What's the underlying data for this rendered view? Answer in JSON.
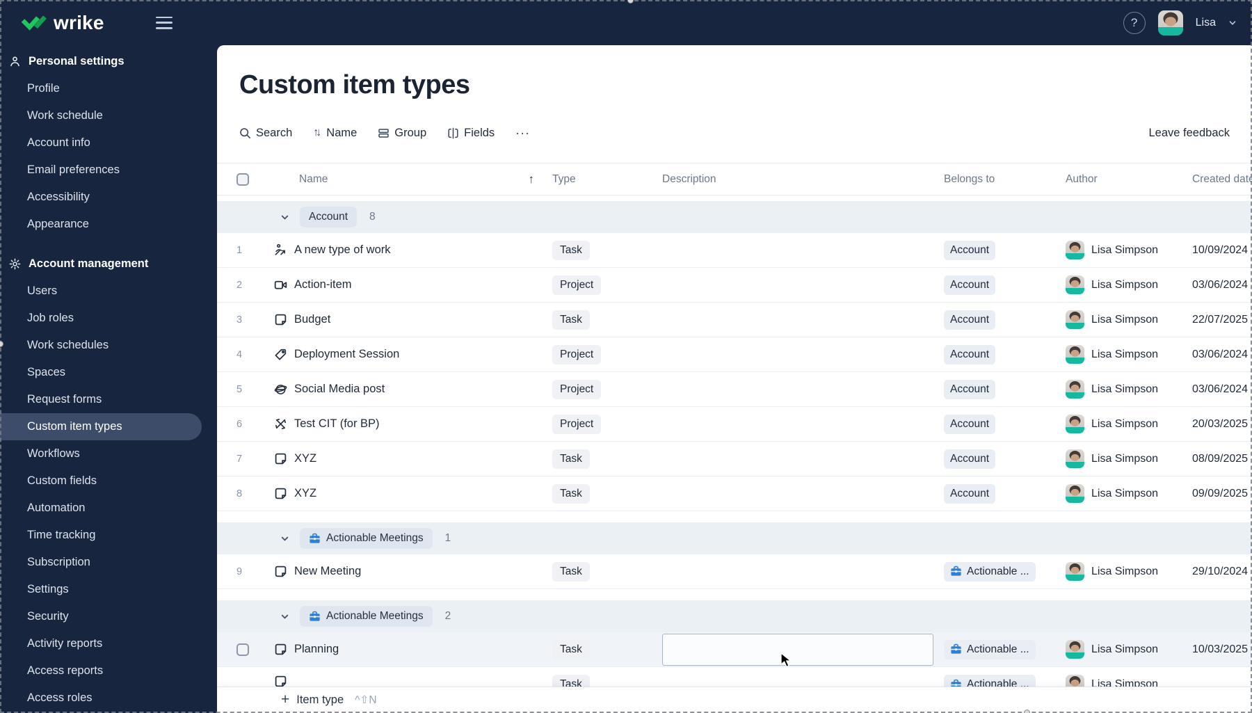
{
  "colors": {
    "brand_green": "#21C561",
    "navy": "#17263E",
    "briefcase_blue": "#2E7FD4",
    "group_band": "#EAF0F4"
  },
  "topbar": {
    "logo_text": "wrike",
    "help_label": "?",
    "user_name": "Lisa"
  },
  "sidebar": {
    "sections": [
      {
        "label": "Personal settings",
        "icon": "person-icon",
        "items": [
          {
            "label": "Profile"
          },
          {
            "label": "Work schedule"
          },
          {
            "label": "Account info"
          },
          {
            "label": "Email preferences"
          },
          {
            "label": "Accessibility"
          },
          {
            "label": "Appearance"
          }
        ]
      },
      {
        "label": "Account management",
        "icon": "gear-icon",
        "items": [
          {
            "label": "Users"
          },
          {
            "label": "Job roles"
          },
          {
            "label": "Work schedules"
          },
          {
            "label": "Spaces"
          },
          {
            "label": "Request forms"
          },
          {
            "label": "Custom item types",
            "selected": true
          },
          {
            "label": "Workflows"
          },
          {
            "label": "Custom fields"
          },
          {
            "label": "Automation"
          },
          {
            "label": "Time tracking"
          },
          {
            "label": "Subscription"
          },
          {
            "label": "Settings"
          },
          {
            "label": "Security"
          },
          {
            "label": "Activity reports"
          },
          {
            "label": "Access reports"
          },
          {
            "label": "Access roles"
          }
        ]
      }
    ]
  },
  "main": {
    "title": "Custom item types",
    "toolbar": {
      "search_label": "Search",
      "sort_label": "Name",
      "group_label": "Group",
      "fields_label": "Fields",
      "more_label": "···",
      "leave_feedback_label": "Leave feedback"
    },
    "table": {
      "header": {
        "name": "Name",
        "sort_dir": "↑",
        "type": "Type",
        "description": "Description",
        "belongs_to": "Belongs to",
        "author": "Author",
        "created_date": "Created date"
      },
      "groups": [
        {
          "label": "Account",
          "count": "8",
          "icon": null,
          "rows": [
            {
              "num": "1",
              "icon": "person-trend-icon",
              "name": "A new type of work",
              "type": "Task",
              "belongs_to": "Account",
              "author": "Lisa Simpson",
              "created": "10/09/2024"
            },
            {
              "num": "2",
              "icon": "video-camera-icon",
              "name": "Action-item",
              "type": "Project",
              "belongs_to": "Account",
              "author": "Lisa Simpson",
              "created": "03/06/2024"
            },
            {
              "num": "3",
              "icon": "note-icon",
              "name": "Budget",
              "type": "Task",
              "belongs_to": "Account",
              "author": "Lisa Simpson",
              "created": "22/07/2025"
            },
            {
              "num": "4",
              "icon": "tag-icon",
              "name": "Deployment Session",
              "type": "Project",
              "belongs_to": "Account",
              "author": "Lisa Simpson",
              "created": "03/06/2024"
            },
            {
              "num": "5",
              "icon": "globe-icon",
              "name": "Social Media post",
              "type": "Project",
              "belongs_to": "Account",
              "author": "Lisa Simpson",
              "created": "03/06/2024"
            },
            {
              "num": "6",
              "icon": "pinwheel-icon",
              "name": "Test CIT (for BP)",
              "type": "Project",
              "belongs_to": "Account",
              "author": "Lisa Simpson",
              "created": "20/03/2025"
            },
            {
              "num": "7",
              "icon": "note-icon",
              "name": "XYZ",
              "type": "Task",
              "belongs_to": "Account",
              "author": "Lisa Simpson",
              "created": "08/09/2025"
            },
            {
              "num": "8",
              "icon": "note-icon",
              "name": "XYZ",
              "type": "Task",
              "belongs_to": "Account",
              "author": "Lisa Simpson",
              "created": "09/09/2025"
            }
          ]
        },
        {
          "label": "Actionable Meetings",
          "count": "1",
          "icon": "briefcase-icon",
          "rows": [
            {
              "num": "9",
              "icon": "note-icon",
              "name": "New Meeting",
              "type": "Task",
              "belongs_to": "Actionable ...",
              "belongs_icon": "briefcase-icon",
              "author": "Lisa Simpson",
              "created": "29/10/2024"
            }
          ]
        },
        {
          "label": "Actionable Meetings",
          "count": "2",
          "icon": "briefcase-icon",
          "rows": [
            {
              "num": "",
              "icon": "note-icon",
              "name": "Planning",
              "type": "Task",
              "belongs_to": "Actionable ...",
              "belongs_icon": "briefcase-icon",
              "author": "Lisa Simpson",
              "created": "10/03/2025",
              "hovered": true,
              "checkbox": true
            },
            {
              "num": "",
              "icon": "note-icon",
              "name": "",
              "type": "Task",
              "belongs_to": "Actionable ...",
              "belongs_icon": "briefcase-icon",
              "author": "Lisa Simpson",
              "created": "",
              "partial": true
            }
          ]
        }
      ]
    },
    "footer": {
      "add_label": "Item type",
      "shortcut": "^⇧N"
    }
  }
}
